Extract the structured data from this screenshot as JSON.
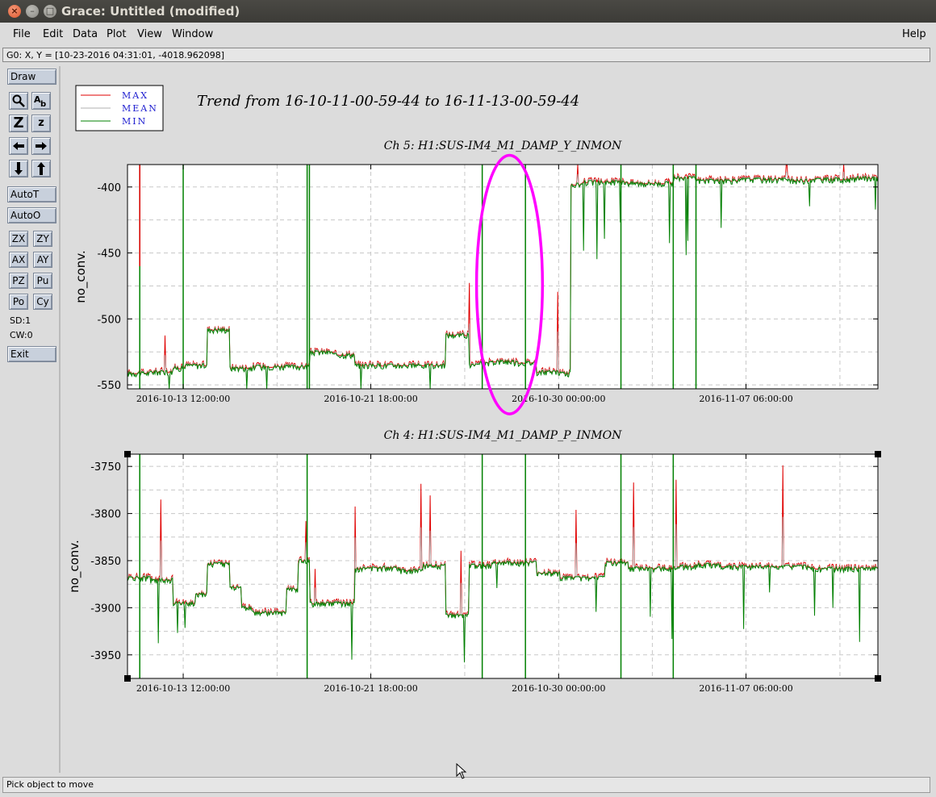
{
  "window": {
    "title": "Grace: Untitled (modified)",
    "close_glyph": "×",
    "min_glyph": "–",
    "max_glyph": "□"
  },
  "menubar": {
    "file": "File",
    "edit": "Edit",
    "data": "Data",
    "plot": "Plot",
    "view": "View",
    "window": "Window",
    "help": "Help"
  },
  "locator": "G0: X, Y = [10-23-2016 04:31:01, -4018.962098]",
  "toolbar": {
    "draw": "Draw",
    "autot": "AutoT",
    "autoo": "AutoO",
    "exit": "Exit",
    "zx": "ZX",
    "zy": "ZY",
    "ax": "AX",
    "ay": "AY",
    "pz": "PZ",
    "pu": "Pu",
    "po": "Po",
    "cy": "Cy",
    "sd": "SD:1",
    "cw": "CW:0",
    "icons": {
      "zoom": "zoom-icon",
      "text": "text-icon",
      "zoom_in": "zoom-in-icon",
      "zoom_out": "zoom-out-icon",
      "left": "arrow-left-icon",
      "right": "arrow-right-icon",
      "down": "arrow-down-icon",
      "up": "arrow-up-icon"
    }
  },
  "plot": {
    "title": "Trend from 16-10-11-00-59-44 to 16-11-13-00-59-44",
    "legend": [
      {
        "name": "MAX",
        "color": "#e00000"
      },
      {
        "name": "MEAN",
        "color": "#b0b0b0"
      },
      {
        "name": "MIN",
        "color": "#008000"
      }
    ]
  },
  "chart_data": [
    {
      "type": "line",
      "title": "Ch 5: H1:SUS-IM4_M1_DAMP_Y_INMON",
      "xlabel": "",
      "ylabel": "no_conv.",
      "x_ticks": [
        "2016-10-13 12:00:00",
        "2016-10-21 18:00:00",
        "2016-10-30 00:00:00",
        "2016-11-07 06:00:00"
      ],
      "y_ticks": [
        "-400",
        "-450",
        "-500",
        "-550"
      ],
      "ylim": [
        -553,
        -383
      ],
      "x_days": [
        0,
        33
      ],
      "grid": true,
      "series": [
        {
          "name": "MAX",
          "color": "#e00000"
        },
        {
          "name": "MEAN",
          "color": "#b0b0b0"
        },
        {
          "name": "MIN",
          "color": "#008000"
        }
      ],
      "x": [
        0,
        1,
        2,
        2.5,
        3,
        3.5,
        4,
        4.5,
        5,
        5.5,
        6,
        7,
        8,
        9,
        10,
        11,
        12,
        13,
        14,
        15,
        15.5,
        16,
        17,
        18,
        19,
        19.5,
        20,
        21,
        22,
        23,
        24,
        25,
        26,
        27,
        28,
        29,
        30,
        31,
        32,
        33
      ],
      "y": [
        -541,
        -540,
        -537,
        -535,
        -535,
        -508,
        -508,
        -537,
        -537,
        -536,
        -536,
        -536,
        -525,
        -527,
        -535,
        -535,
        -535,
        -535,
        -512,
        -535,
        -533,
        -532,
        -533,
        -540,
        -541,
        -398,
        -396,
        -396,
        -397,
        -397,
        -393,
        -395,
        -395,
        -394,
        -394,
        -395,
        -394,
        -394,
        -393,
        -393
      ],
      "annotation": {
        "type": "ellipse",
        "color": "#ff00ff",
        "x": 16.8,
        "y": -474,
        "rx_days": 1.45,
        "ry_units": 98
      }
    },
    {
      "type": "line",
      "title": "Ch 4: H1:SUS-IM4_M1_DAMP_P_INMON",
      "xlabel": "",
      "ylabel": "no_conv.",
      "x_ticks": [
        "2016-10-13 12:00:00",
        "2016-10-21 18:00:00",
        "2016-10-30 00:00:00",
        "2016-11-07 06:00:00"
      ],
      "y_ticks": [
        "-3750",
        "-3800",
        "-3850",
        "-3900",
        "-3950"
      ],
      "ylim": [
        -3975,
        -3737
      ],
      "x_days": [
        0,
        33
      ],
      "grid": true,
      "series": [
        {
          "name": "MAX",
          "color": "#e00000"
        },
        {
          "name": "MEAN",
          "color": "#b0b0b0"
        },
        {
          "name": "MIN",
          "color": "#008000"
        }
      ],
      "x": [
        0,
        1,
        2,
        3,
        3.5,
        4,
        4.5,
        5,
        5.5,
        6,
        7,
        7.5,
        8,
        9,
        9.5,
        10,
        11,
        12,
        13,
        14,
        15,
        16,
        17,
        18,
        19,
        20,
        21,
        22,
        23,
        24,
        25,
        26,
        27,
        28,
        29,
        30,
        31,
        32,
        33
      ],
      "y": [
        -3868,
        -3870,
        -3895,
        -3885,
        -3853,
        -3853,
        -3878,
        -3900,
        -3905,
        -3905,
        -3880,
        -3850,
        -3895,
        -3895,
        -3895,
        -3858,
        -3857,
        -3860,
        -3855,
        -3908,
        -3855,
        -3852,
        -3852,
        -3863,
        -3868,
        -3868,
        -3852,
        -3858,
        -3858,
        -3856,
        -3854,
        -3856,
        -3856,
        -3856,
        -3856,
        -3858,
        -3858,
        -3858,
        -3860
      ]
    }
  ],
  "status": "Pick object to move"
}
